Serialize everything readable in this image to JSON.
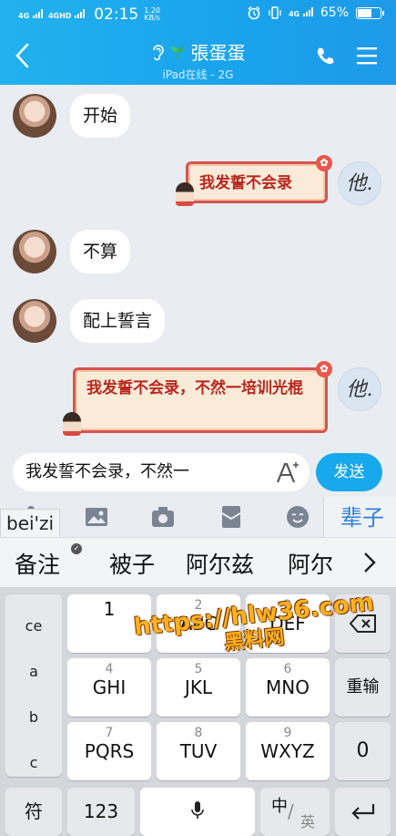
{
  "status_bar": {
    "network_1": "4G",
    "network_2": "4GHD",
    "time": "02:15",
    "speed_value": "1.20",
    "speed_unit": "KB/s",
    "network_3": "4G",
    "battery_percent": "65%",
    "battery_level": 0.65
  },
  "header": {
    "contact_name": "張蛋蛋",
    "device_status": "iPad在线 - 2G",
    "icons": [
      "back-icon",
      "ear-icon",
      "leaf-icon",
      "phone-icon",
      "menu-icon"
    ]
  },
  "messages": [
    {
      "side": "left",
      "type": "text",
      "text": "开始"
    },
    {
      "side": "right",
      "type": "sticker",
      "text": "我发誓不会录",
      "signature": "他."
    },
    {
      "side": "left",
      "type": "text",
      "text": "不算"
    },
    {
      "side": "left",
      "type": "text",
      "text": "配上誓言"
    },
    {
      "side": "right",
      "type": "sticker",
      "text": "我发誓不会录，不然一培训光棍",
      "signature": "他."
    }
  ],
  "input": {
    "value": "我发誓不会录，不然一",
    "send_label": "发送"
  },
  "ime": {
    "pinyin": "bei'zi",
    "preview": "辈子",
    "candidates": [
      "备注",
      "被子",
      "阿尔兹",
      "阿尔"
    ],
    "left_column": [
      "ce",
      "a",
      "b",
      "c"
    ],
    "keys": [
      {
        "num": "",
        "label": "1"
      },
      {
        "num": "2",
        "label": "ABC"
      },
      {
        "num": "3",
        "label": "DEF"
      },
      {
        "num": "4",
        "label": "GHI"
      },
      {
        "num": "5",
        "label": "JKL"
      },
      {
        "num": "6",
        "label": "MNO"
      },
      {
        "num": "7",
        "label": "PQRS"
      },
      {
        "num": "8",
        "label": "TUV"
      },
      {
        "num": "9",
        "label": "WXYZ"
      }
    ],
    "reinput_label": "重输",
    "zero_label": "0",
    "symbol_label": "符",
    "num_label": "123",
    "lang_cn": "中",
    "lang_en": "英"
  },
  "watermark": {
    "url": "https://hlw36.com",
    "name": "黑料网"
  },
  "colors": {
    "header_blue": "#1aa3ec",
    "send_blue": "#18a8ec",
    "sticker_red": "#d6544f",
    "watermark_orange": "#ffb21e"
  }
}
